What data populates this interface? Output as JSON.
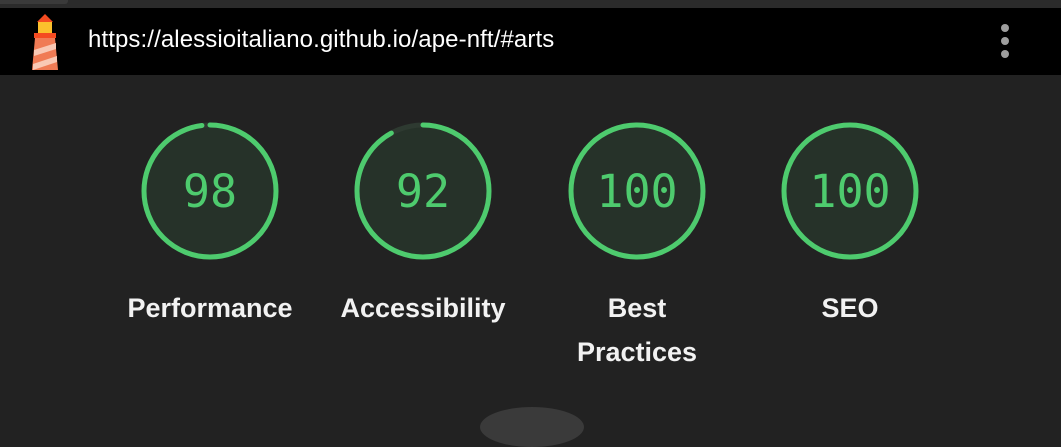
{
  "header": {
    "url": "https://alessioitaliano.github.io/ape-nft/#arts",
    "logo_icon": "lighthouse-icon",
    "menu_icon": "more-vertical-icon"
  },
  "colors": {
    "pass": "#4ecb6e",
    "gauge_fill": "#263229",
    "gauge_track": "#2e3a31",
    "background": "#222222"
  },
  "gauges": [
    {
      "label": "Performance",
      "score": "98",
      "fraction": 0.98
    },
    {
      "label": "Accessibility",
      "score": "92",
      "fraction": 0.92
    },
    {
      "label": "Best\nPractices",
      "score": "100",
      "fraction": 1.0
    },
    {
      "label": "SEO",
      "score": "100",
      "fraction": 1.0
    }
  ]
}
